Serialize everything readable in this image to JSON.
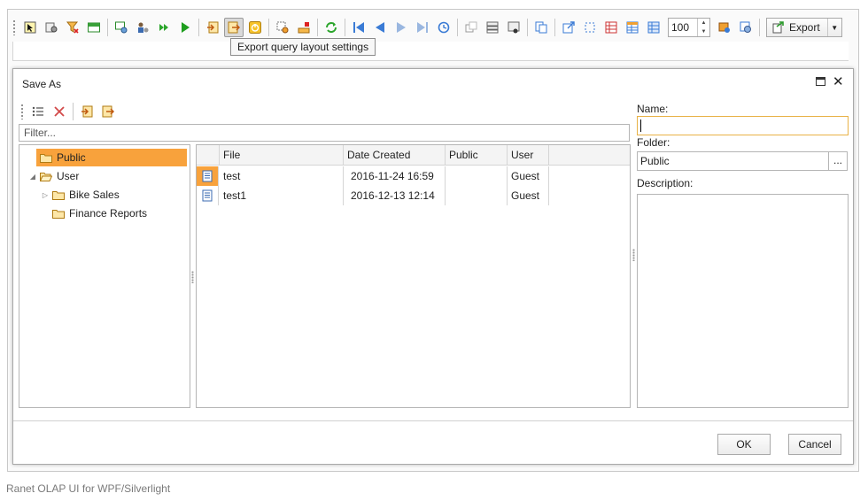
{
  "toolbar": {
    "zoom_value": "100",
    "export_label": "Export",
    "tooltip": "Export query layout settings"
  },
  "dialog": {
    "title": "Save As",
    "filter_placeholder": "Filter...",
    "tree": [
      {
        "label": "Public",
        "selected": true
      },
      {
        "label": "User"
      },
      {
        "label": "Bike Sales"
      },
      {
        "label": "Finance Reports"
      }
    ],
    "grid": {
      "columns": [
        "File",
        "Date Created",
        "Public",
        "User"
      ],
      "rows": [
        {
          "file": "test",
          "date": "2016-11-24 16:59",
          "public": "",
          "user": "Guest"
        },
        {
          "file": "test1",
          "date": "2016-12-13 12:14",
          "public": "",
          "user": "Guest"
        }
      ]
    },
    "name_label": "Name:",
    "name_value": "",
    "folder_label": "Folder:",
    "folder_value": "Public",
    "browse_label": "...",
    "description_label": "Description:",
    "ok_label": "OK",
    "cancel_label": "Cancel"
  },
  "brand": "Ranet OLAP UI for WPF/Silverlight"
}
